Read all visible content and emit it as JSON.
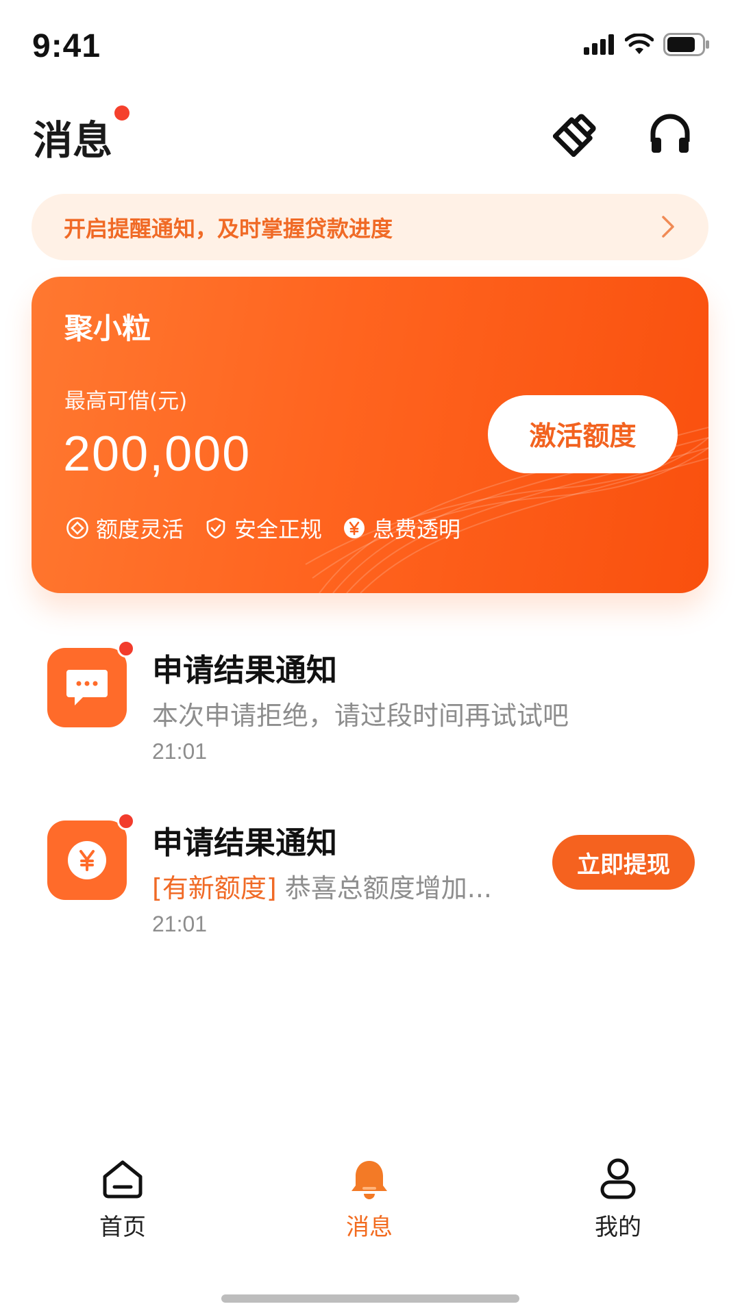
{
  "status_bar": {
    "time": "9:41",
    "icons": [
      "cellular-signal-icon",
      "wifi-icon",
      "battery-icon"
    ]
  },
  "header": {
    "title": "消息",
    "has_unread_dot": true,
    "actions": [
      "clear-read-icon",
      "customer-service-headset-icon"
    ]
  },
  "notice": {
    "text": "开启提醒通知，及时掌握贷款进度",
    "icon": "chevron-right-icon"
  },
  "credit_card": {
    "brand": "聚小粒",
    "limit_label": "最高可借(元)",
    "amount": "200,000",
    "button_label": "激活额度",
    "features": [
      {
        "label": "额度灵活",
        "icon": "diamond-circle-icon"
      },
      {
        "label": "安全正规",
        "icon": "shield-check-icon"
      },
      {
        "label": "息费透明",
        "icon": "yen-circle-icon"
      }
    ]
  },
  "messages": [
    {
      "title": "申请结果通知",
      "description": "本次申请拒绝，请过段时间再试试吧",
      "time": "21:01",
      "icon": "chat-bubble-icon",
      "unread": true
    },
    {
      "title": "申请结果通知",
      "tag": "[有新额度]",
      "description": " 恭喜总额度增加...",
      "time": "21:01",
      "icon": "yen-coin-icon",
      "unread": true,
      "action_label": "立即提现"
    }
  ],
  "tab_bar": {
    "tabs": [
      {
        "label": "首页",
        "icon": "home-icon",
        "active": false
      },
      {
        "label": "消息",
        "icon": "bell-icon",
        "active": true
      },
      {
        "label": "我的",
        "icon": "person-icon",
        "active": false
      }
    ]
  },
  "colors": {
    "accent": "#f5621f",
    "notice_bg": "#fff1e6",
    "unread_dot": "#f23c2c",
    "muted_text": "#8d8d8d"
  }
}
